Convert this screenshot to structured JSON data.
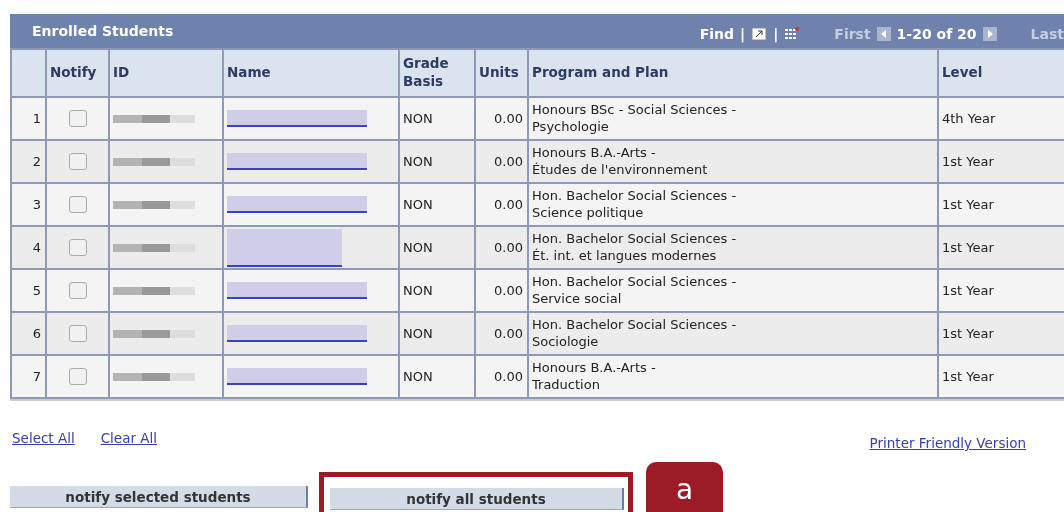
{
  "grid": {
    "title": "Enrolled Students",
    "find": "Find",
    "separators": [
      "|",
      "|"
    ],
    "first": "First",
    "range": "1-20 of 20",
    "last": "Last"
  },
  "columns": [
    "Notify",
    "ID",
    "Name",
    "Grade Basis",
    "Units",
    "Program and Plan",
    "Level"
  ],
  "rows": [
    {
      "index": "1",
      "notify": false,
      "grade": "NON",
      "units": "0.00",
      "program": [
        "Honours BSc - Social Sciences -",
        "Psychologie"
      ],
      "level": "4th Year"
    },
    {
      "index": "2",
      "notify": false,
      "grade": "NON",
      "units": "0.00",
      "program": [
        "Honours B.A.-Arts -",
        "Études de l'environnement"
      ],
      "level": "1st Year"
    },
    {
      "index": "3",
      "notify": false,
      "grade": "NON",
      "units": "0.00",
      "program": [
        "Hon. Bachelor Social Sciences -",
        "Science politique"
      ],
      "level": "1st Year"
    },
    {
      "index": "4",
      "notify": false,
      "grade": "NON",
      "units": "0.00",
      "program": [
        "Hon. Bachelor Social Sciences -",
        "Ét. int. et langues modernes"
      ],
      "level": "1st Year"
    },
    {
      "index": "5",
      "notify": false,
      "grade": "NON",
      "units": "0.00",
      "program": [
        "Hon. Bachelor Social Sciences -",
        "Service social"
      ],
      "level": "1st Year"
    },
    {
      "index": "6",
      "notify": false,
      "grade": "NON",
      "units": "0.00",
      "program": [
        "Hon. Bachelor Social Sciences -",
        "Sociologie"
      ],
      "level": "1st Year"
    },
    {
      "index": "7",
      "notify": false,
      "grade": "NON",
      "units": "0.00",
      "program": [
        "Honours B.A.-Arts -",
        "Traduction"
      ],
      "level": "1st Year"
    }
  ],
  "links": [
    "Select All",
    "Clear All"
  ],
  "printer_link": "Printer Friendly Version",
  "buttons": [
    {
      "label": "notify selected students",
      "highlighted": false
    },
    {
      "label": "notify all students",
      "highlighted": true
    }
  ],
  "callout": "a"
}
